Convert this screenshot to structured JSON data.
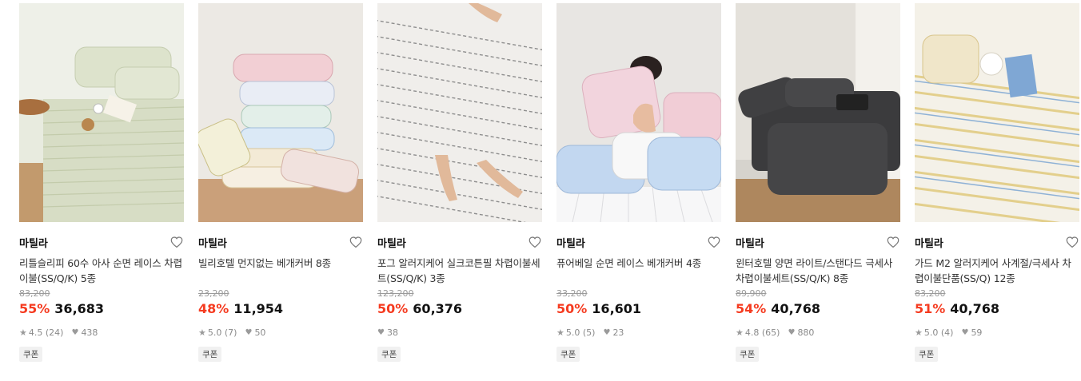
{
  "products": [
    {
      "brand": "마틸라",
      "title": "리틀슬리피 60수 아사 순면 레이스 차렵이불(SS/Q/K) 5종",
      "original_price": "83,200",
      "discount": "55%",
      "price": "36,683",
      "rating": "4.5",
      "reviews": "(24)",
      "likes": "438",
      "coupon": "쿠폰",
      "image_colors": [
        "#dfe3d0",
        "#c9d1b3",
        "#b88b5e"
      ]
    },
    {
      "brand": "마틸라",
      "title": "빌리호텔 먼지없는 베개커버 8종",
      "original_price": "23,200",
      "discount": "48%",
      "price": "11,954",
      "rating": "5.0",
      "reviews": "(7)",
      "likes": "50",
      "coupon": "쿠폰",
      "image_colors": [
        "#ece8e2",
        "#e8b7be",
        "#c59a6d"
      ]
    },
    {
      "brand": "마틸라",
      "title": "포그 알러지케어 실크코튼필 차렵이불세트(SS/Q/K) 3종",
      "original_price": "123,200",
      "discount": "50%",
      "price": "60,376",
      "rating": "",
      "reviews": "",
      "likes": "38",
      "coupon": "쿠폰",
      "image_colors": [
        "#efedea",
        "#8c8c8c",
        "#d9b59a"
      ]
    },
    {
      "brand": "마틸라",
      "title": "퓨어베일 순면 레이스 베개커버 4종",
      "original_price": "33,200",
      "discount": "50%",
      "price": "16,601",
      "rating": "5.0",
      "reviews": "(5)",
      "likes": "23",
      "coupon": "쿠폰",
      "image_colors": [
        "#e9e7e4",
        "#b8d0ec",
        "#f1c7d1"
      ]
    },
    {
      "brand": "마틸라",
      "title": "윈터호텔 양면 라이트/스탠다드 극세사 차렵이불세트(SS/Q/K) 8종",
      "original_price": "89,900",
      "discount": "54%",
      "price": "40,768",
      "rating": "4.8",
      "reviews": "(65)",
      "likes": "880",
      "coupon": "쿠폰",
      "image_colors": [
        "#dedbd5",
        "#3a3a3a",
        "#a9815a"
      ]
    },
    {
      "brand": "마틸라",
      "title": "가드 M2 알러지케어 사계절/극세사 차렵이불단품(SS/Q) 12종",
      "original_price": "83,200",
      "discount": "51%",
      "price": "40,768",
      "rating": "5.0",
      "reviews": "(4)",
      "likes": "59",
      "coupon": "쿠폰",
      "image_colors": [
        "#f1ede2",
        "#e8d9a5",
        "#7fa6cf"
      ]
    }
  ]
}
